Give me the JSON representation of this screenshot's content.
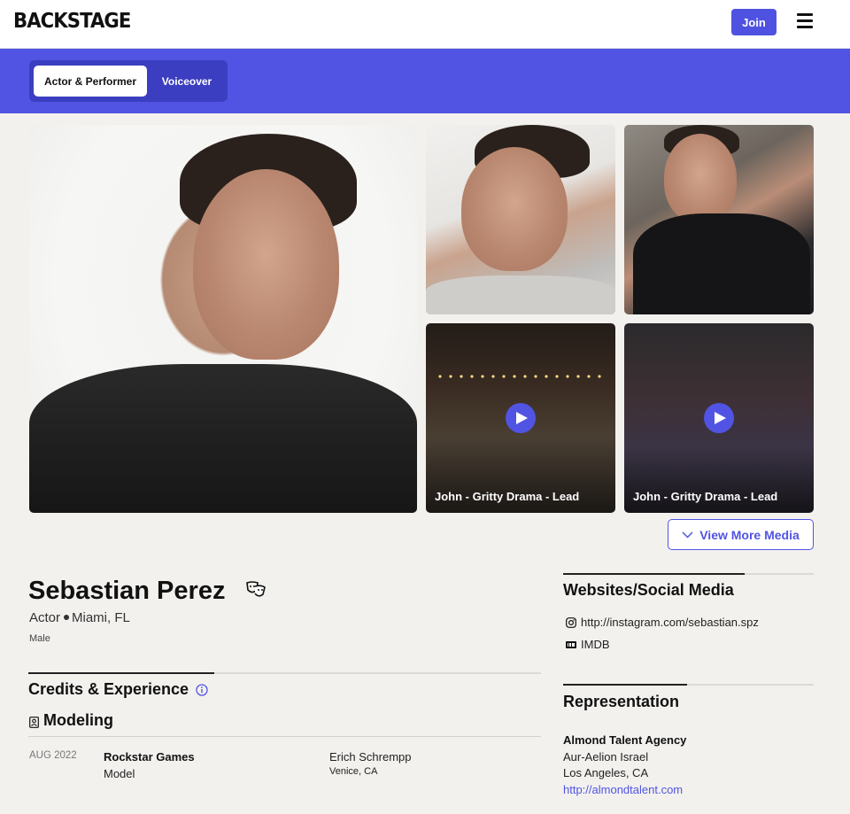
{
  "header": {
    "logo": "BACKSTAGE",
    "join_label": "Join"
  },
  "tabs": [
    {
      "label": "Actor & Performer",
      "active": true
    },
    {
      "label": "Voiceover",
      "active": false
    }
  ],
  "media": {
    "videos": [
      {
        "caption": "John - Gritty Drama - Lead"
      },
      {
        "caption": "John - Gritty Drama - Lead"
      }
    ],
    "view_more_label": "View More Media"
  },
  "profile": {
    "name": "Sebastian Perez",
    "role": "Actor",
    "location": "Miami, FL",
    "gender": "Male"
  },
  "credits": {
    "title": "Credits & Experience",
    "category": "Modeling",
    "items": [
      {
        "date": "AUG 2022",
        "company": "Rockstar Games",
        "role": "Model",
        "director": "Erich Schrempp",
        "location": "Venice, CA"
      }
    ]
  },
  "websites": {
    "title": "Websites/Social Media",
    "links": [
      {
        "icon": "instagram-icon",
        "label": "http://instagram.com/sebastian.spz"
      },
      {
        "icon": "imdb-icon",
        "label": "IMDB"
      }
    ]
  },
  "representation": {
    "title": "Representation",
    "agency": "Almond Talent Agency",
    "agent": "Aur-Aelion Israel",
    "city": "Los Angeles, CA",
    "url": "http://almondtalent.com"
  },
  "colors": {
    "accent": "#5154e3",
    "accent_dark": "#3b3ec0",
    "background": "#f2f1ee"
  }
}
